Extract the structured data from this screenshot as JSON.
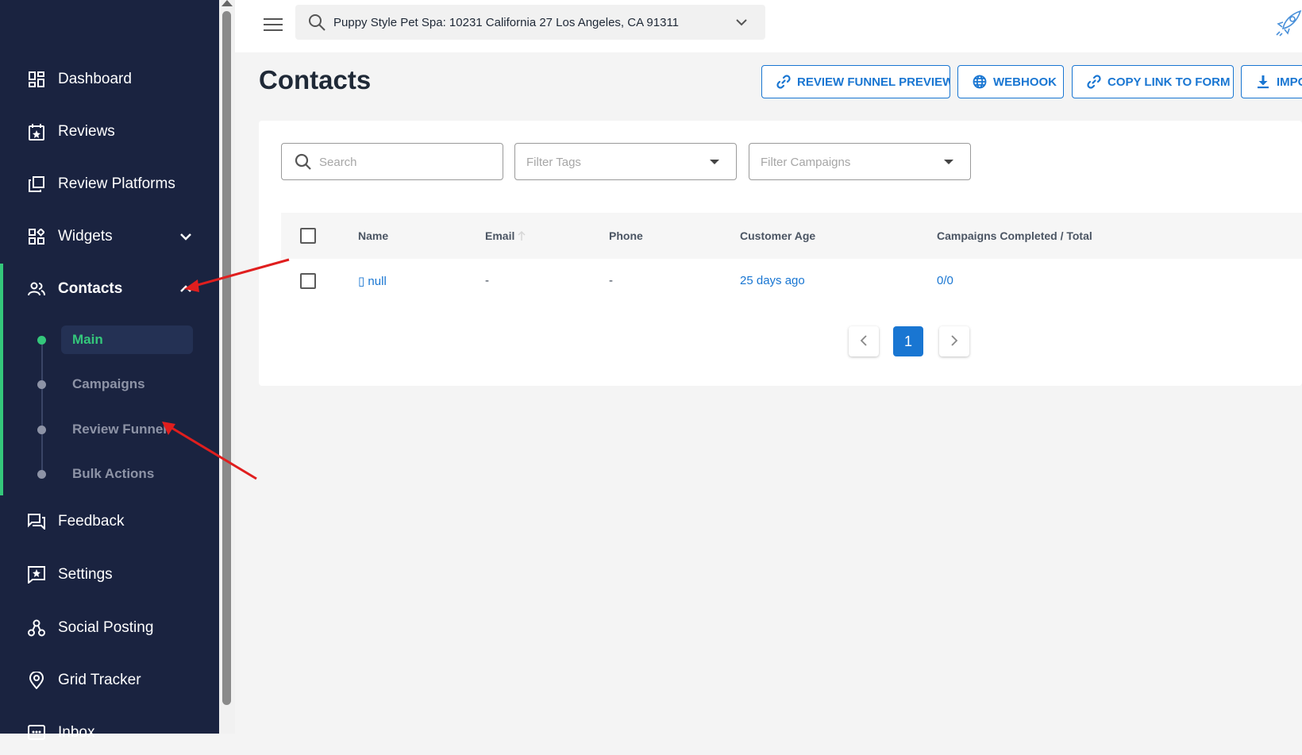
{
  "topbar": {
    "location": "Puppy Style Pet Spa: 10231 California 27 Los Angeles, CA 91311"
  },
  "sidebar": {
    "items": [
      {
        "label": "Dashboard",
        "icon": "dashboard-icon"
      },
      {
        "label": "Reviews",
        "icon": "calendar-star-icon"
      },
      {
        "label": "Review Platforms",
        "icon": "copy-icon"
      },
      {
        "label": "Widgets",
        "icon": "widgets-icon"
      },
      {
        "label": "Contacts",
        "icon": "contacts-icon"
      },
      {
        "label": "Feedback",
        "icon": "forum-icon"
      },
      {
        "label": "Settings",
        "icon": "star-box-icon"
      },
      {
        "label": "Social Posting",
        "icon": "hub-icon"
      },
      {
        "label": "Grid Tracker",
        "icon": "location-icon"
      },
      {
        "label": "Inbox",
        "icon": "inbox-icon"
      }
    ],
    "contacts_sub": [
      "Main",
      "Campaigns",
      "Review Funnel",
      "Bulk Actions"
    ]
  },
  "page": {
    "title": "Contacts",
    "buttons": {
      "review_funnel_preview": "REVIEW FUNNEL PREVIEW",
      "webhook": "WEBHOOK",
      "copy_link": "COPY LINK TO FORM",
      "import": "IMPO"
    }
  },
  "filters": {
    "search_placeholder": "Search",
    "tags_placeholder": "Filter Tags",
    "campaigns_placeholder": "Filter Campaigns"
  },
  "table": {
    "columns": [
      "Name",
      "Email",
      "Phone",
      "Customer Age",
      "Campaigns Completed / Total"
    ],
    "rows": [
      {
        "name": "▯ null",
        "email": "-",
        "phone": "-",
        "age": "25 days ago",
        "campaigns": "0/0"
      }
    ]
  },
  "pagination": {
    "current": "1"
  },
  "colors": {
    "sidebar": "#1a2340",
    "accent": "#1976d2",
    "active": "#34c77b",
    "annotation": "#e01e1e"
  }
}
